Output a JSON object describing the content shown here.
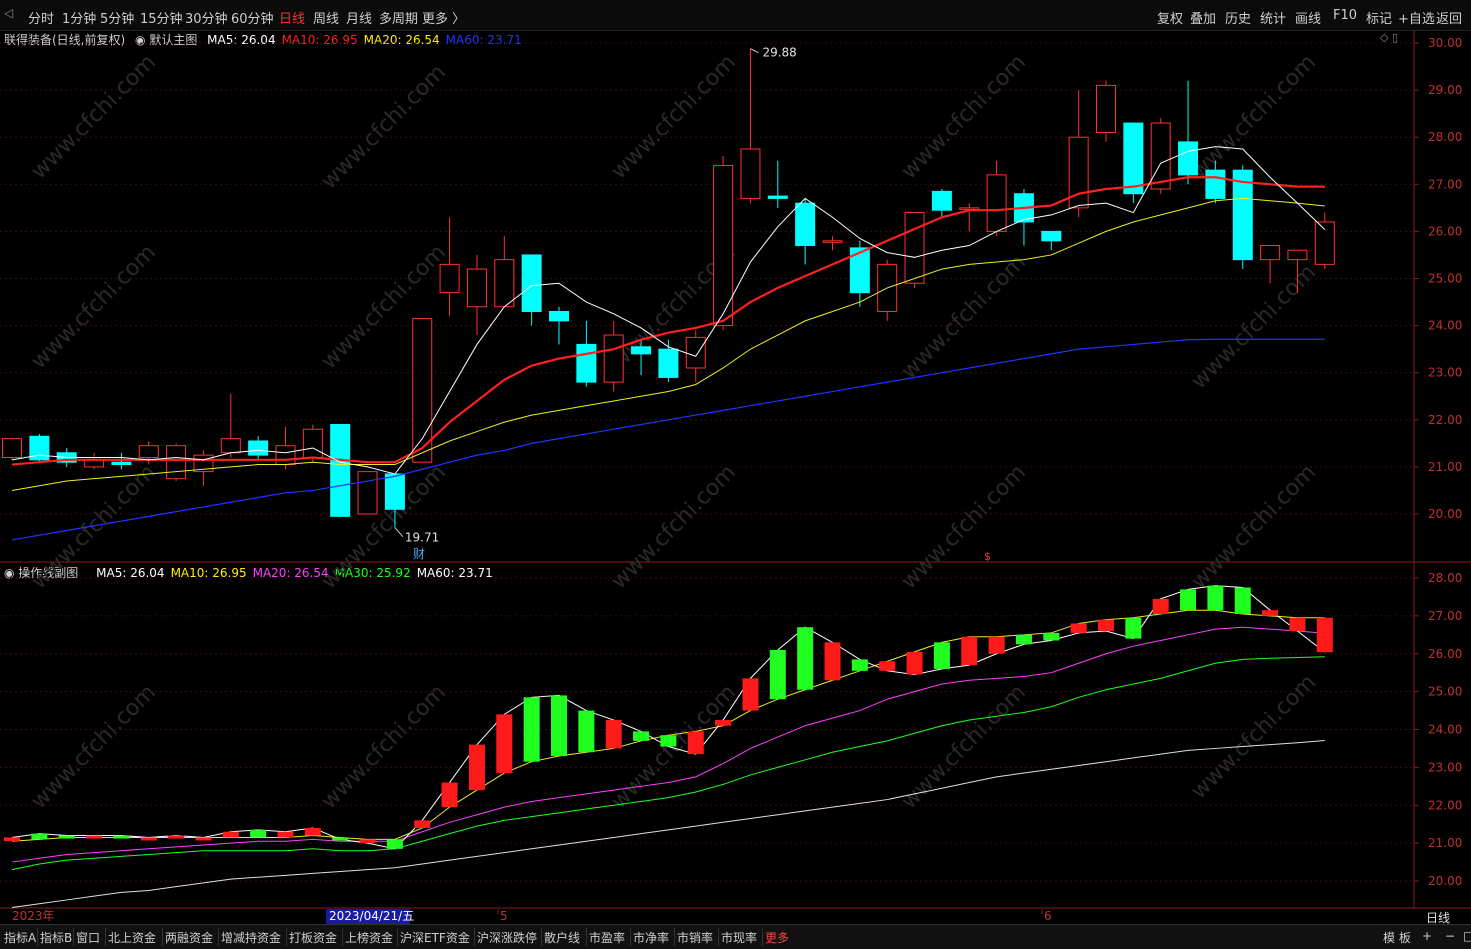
{
  "topbar": {
    "tabs": [
      "分时",
      "1分钟",
      "5分钟",
      "15分钟",
      "30分钟",
      "60分钟",
      "日线",
      "周线",
      "月线",
      "多周期",
      "更多 〉"
    ],
    "active_tab": "日线",
    "right_buttons": [
      "复权",
      "叠加",
      "历史",
      "统计",
      "画线",
      "F10",
      "标记",
      "+自选",
      "返回"
    ]
  },
  "main": {
    "stock_label": "联得装备(日线,前复权)",
    "indicator": "默认主图",
    "ma": [
      {
        "label": "MA5:",
        "value": "26.04",
        "color": "#ffffff"
      },
      {
        "label": "MA10:",
        "value": "26.95",
        "color": "#ff2020"
      },
      {
        "label": "MA20:",
        "value": "26.54",
        "color": "#ffee00"
      },
      {
        "label": "MA60:",
        "value": "23.71",
        "color": "#2233ff"
      }
    ],
    "price_labels": [
      "30.00",
      "29.00",
      "28.00",
      "27.00",
      "26.00",
      "25.00",
      "24.00",
      "23.00",
      "22.00",
      "21.00",
      "20.00"
    ],
    "high_label": "29.88",
    "low_label": "19.71",
    "marker_cai": "财",
    "marker_s": "$"
  },
  "sub": {
    "indicator": "操作线副图",
    "ma": [
      {
        "label": "MA5:",
        "value": "26.04",
        "color": "#ffffff"
      },
      {
        "label": "MA10:",
        "value": "26.95",
        "color": "#ffee00"
      },
      {
        "label": "MA20:",
        "value": "26.54",
        "color": "#ff40ff"
      },
      {
        "label": "MA30:",
        "value": "25.92",
        "color": "#20ff20"
      },
      {
        "label": "MA60:",
        "value": "23.71",
        "color": "#ffffff"
      }
    ],
    "price_labels": [
      "28.00",
      "27.00",
      "26.00",
      "25.00",
      "24.00",
      "23.00",
      "22.00",
      "21.00",
      "20.00"
    ]
  },
  "date_axis": {
    "year": "2023年",
    "cursor_date": "2023/04/21/五",
    "month5": "5",
    "month6": "6",
    "period": "日线"
  },
  "bottombar": {
    "tabs": [
      "指标A",
      "指标B",
      "窗口",
      "北上资金",
      "两融资金",
      "增减持资金",
      "打板资金",
      "上榜资金",
      "沪深ETF资金",
      "沪深涨跌停",
      "散户线",
      "市盈率",
      "市净率",
      "市销率",
      "市现率",
      "更多"
    ],
    "right": [
      "模 板",
      "+",
      "−",
      "□"
    ]
  },
  "watermark": "www.cfchi.com",
  "chart_data": {
    "type": "candlestick",
    "ylim": [
      19.4,
      30.2
    ],
    "candles": [
      [
        21.2,
        21.6,
        21.15,
        21.45
      ],
      [
        21.65,
        21.15,
        21.1,
        21.7
      ],
      [
        21.3,
        21.1,
        21.0,
        21.4
      ],
      [
        21.0,
        21.15,
        20.95,
        21.3
      ],
      [
        21.1,
        21.05,
        20.95,
        21.3
      ],
      [
        21.2,
        21.45,
        21.05,
        21.55
      ],
      [
        20.75,
        21.45,
        20.7,
        21.5
      ],
      [
        20.9,
        21.25,
        20.6,
        21.35
      ],
      [
        21.3,
        21.6,
        21.2,
        22.55
      ],
      [
        21.55,
        21.25,
        21.15,
        21.65
      ],
      [
        21.05,
        21.45,
        20.95,
        21.85
      ],
      [
        21.2,
        21.8,
        21.1,
        21.9
      ],
      [
        21.9,
        19.95,
        19.95,
        21.9
      ],
      [
        20.0,
        20.9,
        20.0,
        20.9
      ],
      [
        20.85,
        20.1,
        19.71,
        20.85
      ],
      [
        21.1,
        24.15,
        21.1,
        24.15
      ],
      [
        24.7,
        25.3,
        24.2,
        26.3
      ],
      [
        24.4,
        25.2,
        23.8,
        25.5
      ],
      [
        24.4,
        25.4,
        24.4,
        25.9
      ],
      [
        25.5,
        24.3,
        24.0,
        25.5
      ],
      [
        24.3,
        24.1,
        23.6,
        24.4
      ],
      [
        23.6,
        22.8,
        22.7,
        24.1
      ],
      [
        22.8,
        23.8,
        22.6,
        24.1
      ],
      [
        23.55,
        23.4,
        22.95,
        23.7
      ],
      [
        23.5,
        22.9,
        22.8,
        23.7
      ],
      [
        23.1,
        23.75,
        22.8,
        23.9
      ],
      [
        24.0,
        27.4,
        23.9,
        27.6
      ],
      [
        26.7,
        27.75,
        26.6,
        29.88
      ],
      [
        26.75,
        26.7,
        26.5,
        27.5
      ],
      [
        26.6,
        25.7,
        25.3,
        26.7
      ],
      [
        25.8,
        25.8,
        25.6,
        25.9
      ],
      [
        25.65,
        24.7,
        24.4,
        25.8
      ],
      [
        24.3,
        25.3,
        24.1,
        25.4
      ],
      [
        24.9,
        26.4,
        24.8,
        26.4
      ],
      [
        26.85,
        26.45,
        26.3,
        26.9
      ],
      [
        26.5,
        26.5,
        26.0,
        26.6
      ],
      [
        26.0,
        27.2,
        25.9,
        27.5
      ],
      [
        26.8,
        26.2,
        25.7,
        26.9
      ],
      [
        26.0,
        25.8,
        25.6,
        26.0
      ],
      [
        26.5,
        28.0,
        26.3,
        29.0
      ],
      [
        28.1,
        29.1,
        27.9,
        29.2
      ],
      [
        28.3,
        26.8,
        26.6,
        28.3
      ],
      [
        26.9,
        28.3,
        26.8,
        28.4
      ],
      [
        27.9,
        27.2,
        27.0,
        29.2
      ],
      [
        27.3,
        26.7,
        26.6,
        27.5
      ],
      [
        27.3,
        25.4,
        25.2,
        27.4
      ],
      [
        25.4,
        25.7,
        24.9,
        25.7
      ],
      [
        25.4,
        25.6,
        24.7,
        25.6
      ],
      [
        25.3,
        26.2,
        25.2,
        26.4
      ]
    ],
    "ma5": [
      21.15,
      21.25,
      21.2,
      21.2,
      21.2,
      21.15,
      21.2,
      21.15,
      21.3,
      21.35,
      21.3,
      21.4,
      21.1,
      21.0,
      20.85,
      21.6,
      22.6,
      23.6,
      24.4,
      24.85,
      24.9,
      24.5,
      24.25,
      23.95,
      23.55,
      23.35,
      24.25,
      25.35,
      26.1,
      26.7,
      26.3,
      25.85,
      25.55,
      25.45,
      25.6,
      25.7,
      26.0,
      26.25,
      26.35,
      26.55,
      26.6,
      26.4,
      27.45,
      27.7,
      27.8,
      27.75,
      27.15,
      26.6,
      26.04
    ],
    "ma10": [
      21.05,
      21.1,
      21.15,
      21.15,
      21.15,
      21.15,
      21.15,
      21.15,
      21.15,
      21.15,
      21.15,
      21.2,
      21.15,
      21.1,
      21.1,
      21.4,
      21.95,
      22.4,
      22.85,
      23.15,
      23.3,
      23.4,
      23.5,
      23.7,
      23.85,
      23.95,
      24.1,
      24.5,
      24.8,
      25.05,
      25.3,
      25.55,
      25.8,
      26.05,
      26.3,
      26.45,
      26.45,
      26.5,
      26.55,
      26.8,
      26.9,
      26.95,
      27.05,
      27.15,
      27.15,
      27.05,
      27.0,
      26.95,
      26.95
    ],
    "ma20": [
      20.5,
      20.6,
      20.7,
      20.75,
      20.8,
      20.85,
      20.9,
      20.95,
      21.0,
      21.05,
      21.05,
      21.1,
      21.05,
      21.05,
      21.05,
      21.3,
      21.55,
      21.75,
      21.95,
      22.1,
      22.2,
      22.3,
      22.4,
      22.5,
      22.6,
      22.75,
      23.1,
      23.5,
      23.8,
      24.1,
      24.3,
      24.5,
      24.8,
      25.0,
      25.2,
      25.3,
      25.35,
      25.4,
      25.5,
      25.75,
      26.0,
      26.2,
      26.35,
      26.5,
      26.65,
      26.7,
      26.65,
      26.6,
      26.54
    ],
    "ma60": [
      19.45,
      19.55,
      19.65,
      19.75,
      19.85,
      19.95,
      20.05,
      20.15,
      20.25,
      20.35,
      20.45,
      20.5,
      20.6,
      20.7,
      20.8,
      20.95,
      21.1,
      21.25,
      21.35,
      21.5,
      21.6,
      21.7,
      21.8,
      21.9,
      22.0,
      22.1,
      22.2,
      22.3,
      22.4,
      22.5,
      22.6,
      22.7,
      22.8,
      22.9,
      23.0,
      23.1,
      23.2,
      23.3,
      23.4,
      23.5,
      23.55,
      23.6,
      23.65,
      23.7,
      23.71,
      23.71,
      23.71,
      23.71,
      23.71
    ],
    "sub_ylim": [
      19.4,
      28.4
    ],
    "sub_ma30": [
      20.3,
      20.45,
      20.55,
      20.6,
      20.65,
      20.7,
      20.75,
      20.8,
      20.8,
      20.8,
      20.8,
      20.85,
      20.8,
      20.8,
      20.85,
      21.05,
      21.25,
      21.45,
      21.6,
      21.7,
      21.8,
      21.9,
      22.0,
      22.1,
      22.2,
      22.35,
      22.55,
      22.8,
      23.0,
      23.2,
      23.4,
      23.55,
      23.7,
      23.9,
      24.1,
      24.25,
      24.35,
      24.45,
      24.6,
      24.85,
      25.05,
      25.2,
      25.35,
      25.55,
      25.75,
      25.85,
      25.88,
      25.9,
      25.92
    ],
    "sub_ma60": [
      19.3,
      19.4,
      19.5,
      19.6,
      19.7,
      19.75,
      19.85,
      19.95,
      20.05,
      20.1,
      20.15,
      20.2,
      20.25,
      20.3,
      20.35,
      20.45,
      20.55,
      20.65,
      20.75,
      20.85,
      20.95,
      21.05,
      21.15,
      21.25,
      21.35,
      21.45,
      21.55,
      21.65,
      21.75,
      21.85,
      21.95,
      22.05,
      22.15,
      22.3,
      22.45,
      22.6,
      22.75,
      22.85,
      22.95,
      23.05,
      23.15,
      23.25,
      23.35,
      23.45,
      23.5,
      23.55,
      23.6,
      23.65,
      23.71
    ]
  }
}
